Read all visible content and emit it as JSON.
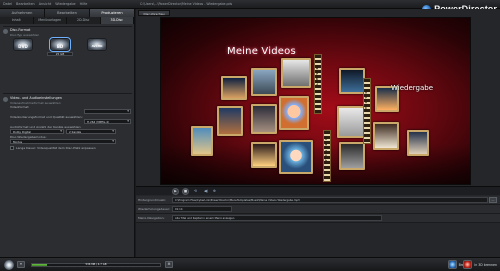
{
  "window": {
    "menu": [
      "Datei",
      "Bearbeiten",
      "Ansicht",
      "Wiedergabe",
      "Hilfe"
    ],
    "path": "C:\\Users\\...\\PowerDirector\\Meine Videos - Wiedergabe.pds",
    "brand": "PowerDirector",
    "brand_sub": "CyberLink"
  },
  "main_tabs": [
    "Aufnehmen",
    "Bearbeiten",
    "Produzieren"
  ],
  "left": {
    "subtabs": [
      "Inhalt",
      "Menüvorlagen",
      "2D-Disc",
      "3D-Disc"
    ],
    "section1_title": "Disc-Format",
    "section1_sub": "Disc-Typ auswählen",
    "discs": [
      {
        "label": "DVD",
        "cap": "4.7 GB"
      },
      {
        "label": "BD",
        "cap": "25 GB"
      },
      {
        "label": "AVCHD",
        "cap": ""
      }
    ],
    "section2_title": "Video- und Audioeinstellungen",
    "section2_sub": "Videoaufnahmeformat auswählen",
    "rows": [
      {
        "label": "Videoformat:",
        "value": ""
      },
      {
        "label": "Videokodierungsformat und Qualität auswählen:",
        "value": "H.264 (MPEG-4)"
      },
      {
        "label": "Audioformat und Anzahl der Kanäle auswählen:",
        "value": "Dolby Digital",
        "value2": "2 Kanäle"
      },
      {
        "label": "Disc-Wiedergabemodus:",
        "value": "Modus"
      }
    ],
    "checkbox_label": "Lange Dauer: Videoqualität dem Disc-Platz anpassen"
  },
  "preview": {
    "tab": "Disc-Vorschau",
    "title": "Meine Videos",
    "subtitle": "Wiedergabe",
    "strips": [
      "BROADWAY",
      "TIMES SQUARE",
      "BROADWAY"
    ]
  },
  "controls": {
    "play": "▶",
    "stop": "■",
    "extra": "⟲",
    "audio": "◀)",
    "zoom": "⊕"
  },
  "info": [
    {
      "label": "Hintergrundmusik:",
      "value": "C:\\Program Files\\CyberLink\\PowerDirector\\MenuTemplates\\Musik\\Meine Videos Wiedergabe.mp3"
    },
    {
      "label": "Wiederholungsdauer:",
      "value": "01:14"
    },
    {
      "label": "Menü-Navigation:",
      "value": "Alle Titel und Kapitel in einem Menü anzeigen"
    }
  ],
  "bottom": {
    "disc_text": "536 MB / 4.7 GB",
    "disc_fill": 0.12,
    "burn_label": "Brennen",
    "three_d_label": "In 3D brennen"
  }
}
